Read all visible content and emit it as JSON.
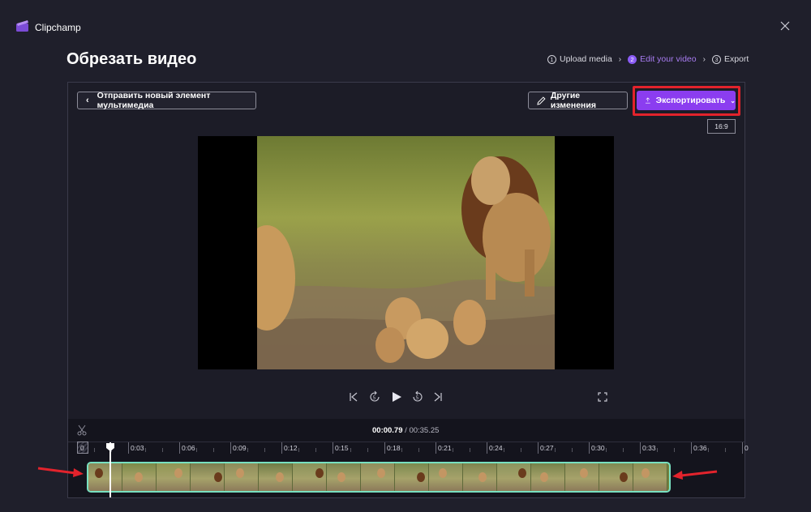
{
  "app": {
    "name": "Clipchamp"
  },
  "page": {
    "title": "Обрезать видео"
  },
  "steps": [
    {
      "num": "1",
      "label": "Upload media",
      "active": false
    },
    {
      "num": "2",
      "label": "Edit your video",
      "active": true
    },
    {
      "num": "3",
      "label": "Export",
      "active": false
    }
  ],
  "toolbar": {
    "back_label": "Отправить новый элемент мультимедиа",
    "changes_label": "Другие изменения",
    "export_label": "Экспортировать",
    "aspect_ratio": "16:9"
  },
  "player": {
    "current_time": "00:00.79",
    "separator": "/",
    "total_time": "00:35.25"
  },
  "timeline": {
    "zero_label": "0",
    "ticks": [
      "0:03",
      "0:06",
      "0:09",
      "0:12",
      "0:15",
      "0:18",
      "0:21",
      "0:24",
      "0:27",
      "0:30",
      "0:33",
      "0:36",
      "0"
    ]
  },
  "colors": {
    "accent": "#8b3df0",
    "highlight_outline": "#e2232c",
    "clip_border": "#78e0c0",
    "annotation_arrow": "#e2232c"
  },
  "icons": [
    "clipchamp-logo-icon",
    "close-icon",
    "chevron-left-icon",
    "pencil-icon",
    "upload-icon",
    "chevron-down-icon",
    "skip-back-icon",
    "rewind-5-icon",
    "play-icon",
    "forward-5-icon",
    "skip-forward-icon",
    "fullscreen-icon",
    "scissors-icon"
  ]
}
